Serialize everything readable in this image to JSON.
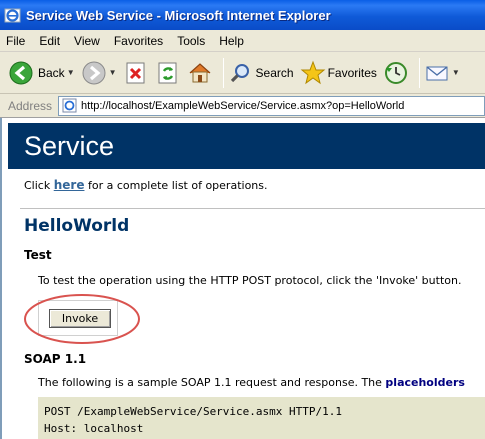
{
  "window": {
    "title": "Service Web Service - Microsoft Internet Explorer"
  },
  "menu": [
    "File",
    "Edit",
    "View",
    "Favorites",
    "Tools",
    "Help"
  ],
  "toolbar": {
    "back_label": "Back",
    "search_label": "Search",
    "favorites_label": "Favorites"
  },
  "address": {
    "label": "Address",
    "url": "http://localhost/ExampleWebService/Service.asmx?op=HelloWorld"
  },
  "page": {
    "banner": "Service",
    "intro_before": "Click ",
    "intro_link": "here",
    "intro_after": " for a complete list of operations.",
    "operation": "HelloWorld",
    "test_heading": "Test",
    "test_description": "To test the operation using the HTTP POST protocol, click the 'Invoke' button.",
    "invoke_label": "Invoke",
    "soap_heading": "SOAP 1.1",
    "soap_desc_before": "The following is a sample SOAP 1.1 request and response. The ",
    "soap_desc_bold": "placeholders",
    "code_line1": "POST /ExampleWebService/Service.asmx HTTP/1.1",
    "code_line2": "Host: localhost"
  },
  "colors": {
    "banner_bg": "#003366",
    "titlebar": "#0a5ee6",
    "highlight": "#d9534f",
    "code_bg": "#e5e5cc"
  }
}
